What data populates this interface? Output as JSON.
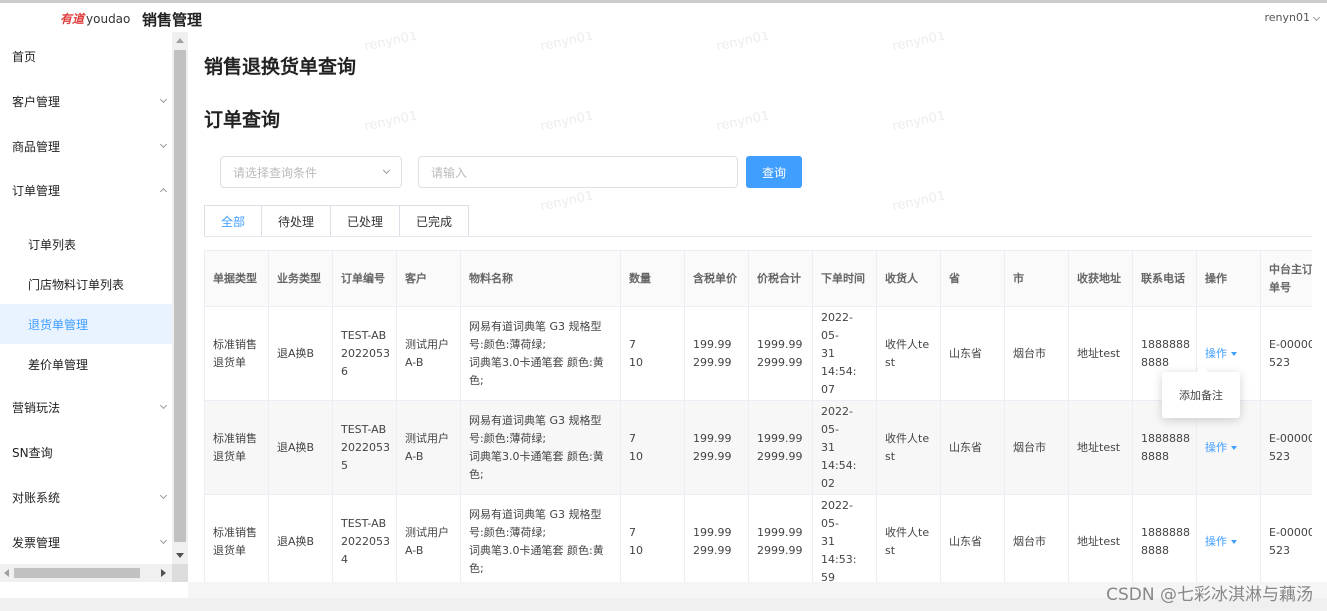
{
  "header": {
    "logo_red": "有道",
    "logo_text": "youdao",
    "app_title": "销售管理",
    "user": "renyn01"
  },
  "sidebar": {
    "items": [
      {
        "label": "首页"
      },
      {
        "label": "客户管理"
      },
      {
        "label": "商品管理"
      },
      {
        "label": "订单管理"
      },
      {
        "label": "订单列表"
      },
      {
        "label": "门店物料订单列表"
      },
      {
        "label": "退货单管理"
      },
      {
        "label": "差价单管理"
      },
      {
        "label": "营销玩法"
      },
      {
        "label": "SN查询"
      },
      {
        "label": "对账系统"
      },
      {
        "label": "发票管理"
      }
    ]
  },
  "main": {
    "page_title": "销售退换货单查询",
    "section_title": "订单查询",
    "search": {
      "select_placeholder": "请选择查询条件",
      "input_placeholder": "请输入",
      "button": "查询"
    },
    "tabs": [
      {
        "label": "全部"
      },
      {
        "label": "待处理"
      },
      {
        "label": "已处理"
      },
      {
        "label": "已完成"
      }
    ],
    "table": {
      "headers": [
        "单据类型",
        "业务类型",
        "订单编号",
        "客户",
        "物料名称",
        "数量",
        "含税单价",
        "价税合计",
        "下单时间",
        "收货人",
        "省",
        "市",
        "收获地址",
        "联系电话",
        "操作",
        "中台主订\n单号"
      ],
      "rows": [
        {
          "doc_type": "标准销售\n退货单",
          "biz_type": "退A换B",
          "order_no": "TEST-AB\n2022053\n6",
          "customer": "测试用户\nA-B",
          "material": "网易有道词典笔 G3 规格型\n号:颜色:薄荷绿;\n词典笔3.0卡通笔套 颜色:黄\n色;",
          "qty": "7\n10",
          "price": "199.99\n299.99",
          "total": "1999.99\n2999.99",
          "time": "2022-05-\n31 14:54:\n07",
          "receiver": "收件人te\nst",
          "province": "山东省",
          "city": "烟台市",
          "address": "地址test",
          "phone": "1888888\n8888",
          "op": "操作",
          "center_no": "E-00000\n523"
        },
        {
          "doc_type": "标准销售\n退货单",
          "biz_type": "退A换B",
          "order_no": "TEST-AB\n2022053\n5",
          "customer": "测试用户\nA-B",
          "material": "网易有道词典笔 G3 规格型\n号:颜色:薄荷绿;\n词典笔3.0卡通笔套 颜色:黄\n色;",
          "qty": "7\n10",
          "price": "199.99\n299.99",
          "total": "1999.99\n2999.99",
          "time": "2022-05-\n31 14:54:\n02",
          "receiver": "收件人te\nst",
          "province": "山东省",
          "city": "烟台市",
          "address": "地址test",
          "phone": "1888888\n8888",
          "op": "操作",
          "center_no": "E-00000\n523"
        },
        {
          "doc_type": "标准销售\n退货单",
          "biz_type": "退A换B",
          "order_no": "TEST-AB\n2022053\n4",
          "customer": "测试用户\nA-B",
          "material": "网易有道词典笔 G3 规格型\n号:颜色:薄荷绿;\n词典笔3.0卡通笔套 颜色:黄\n色;",
          "qty": "7\n10",
          "price": "199.99\n299.99",
          "total": "1999.99\n2999.99",
          "time": "2022-05-\n31 14:53:\n59",
          "receiver": "收件人te\nst",
          "province": "山东省",
          "city": "烟台市",
          "address": "地址test",
          "phone": "1888888\n8888",
          "op": "操作",
          "center_no": "E-00000\n523"
        }
      ]
    },
    "popover": "添加备注"
  },
  "footer": {
    "watermark": "CSDN @七彩冰淇淋与藕汤",
    "page_watermark": "renyn01"
  },
  "colors": {
    "accent": "#409eff",
    "active_bg": "#e9f3ff"
  }
}
